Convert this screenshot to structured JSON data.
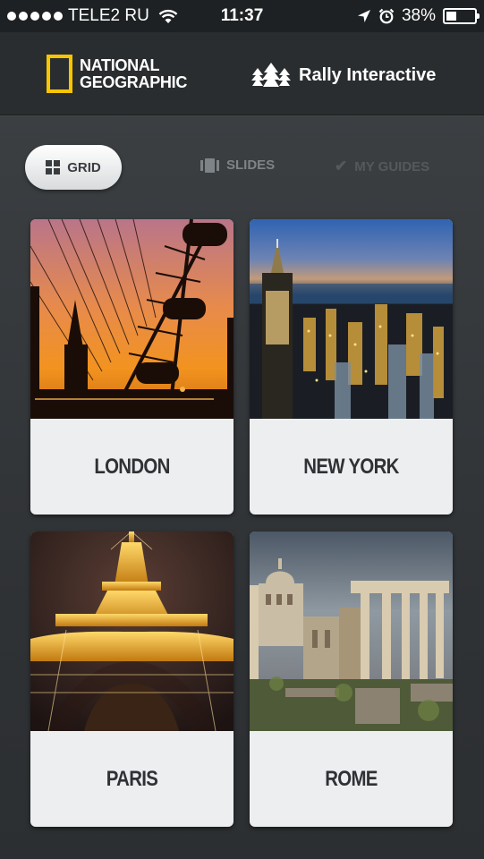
{
  "status_bar": {
    "carrier": "TELE2 RU",
    "time": "11:37",
    "battery_percent_text": "38%",
    "battery_level": 0.38,
    "signal_bars": 5
  },
  "header": {
    "left_logo_text": "NATIONAL\nGEOGRAPHIC",
    "right_logo_text": "Rally Interactive",
    "brand_yellow": "#f7c600"
  },
  "view_tabs": [
    {
      "label": "GRID",
      "icon": "grid-icon",
      "selected": true
    },
    {
      "label": "SLIDES",
      "icon": "slides-icon",
      "selected": false
    },
    {
      "label": "MY GUIDES",
      "icon": "checkmark-icon",
      "selected": false
    }
  ],
  "cities": [
    {
      "name": "LONDON",
      "image": "london-eye-sunset"
    },
    {
      "name": "NEW YORK",
      "image": "new-york-skyline-dusk"
    },
    {
      "name": "PARIS",
      "image": "eiffel-tower-night"
    },
    {
      "name": "ROME",
      "image": "roman-forum-ruins"
    }
  ]
}
